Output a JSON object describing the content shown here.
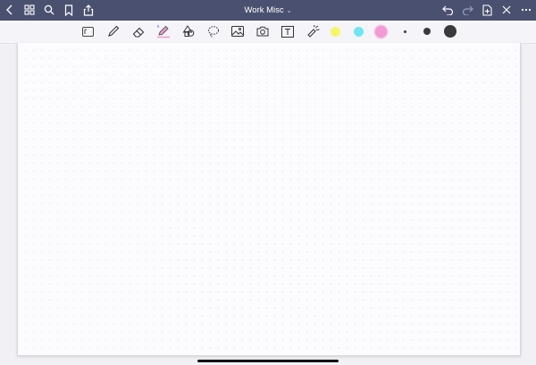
{
  "app": {
    "document_title": "Work Misc",
    "title_caret": "⌄"
  },
  "topbar_left": [
    {
      "name": "back-icon"
    },
    {
      "name": "grid-icon"
    },
    {
      "name": "search-icon"
    },
    {
      "name": "bookmark-icon"
    },
    {
      "name": "share-icon"
    }
  ],
  "topbar_right": [
    {
      "name": "undo-icon"
    },
    {
      "name": "redo-icon"
    },
    {
      "name": "add-page-icon"
    },
    {
      "name": "close-icon"
    },
    {
      "name": "more-icon"
    }
  ],
  "tools": [
    {
      "name": "read-only-icon"
    },
    {
      "name": "pen-icon"
    },
    {
      "name": "eraser-icon"
    },
    {
      "name": "highlighter-icon"
    },
    {
      "name": "shapes-icon"
    },
    {
      "name": "lasso-icon"
    },
    {
      "name": "image-icon"
    },
    {
      "name": "camera-icon"
    },
    {
      "name": "text-box-icon"
    },
    {
      "name": "laser-pointer-icon"
    }
  ],
  "colors": {
    "topbar": "#4a5170",
    "highlighter_yellow": "#f7f56a",
    "highlighter_cyan": "#6ee6ef",
    "highlighter_pink": "#f29ad3",
    "ink": "#3a3a3c",
    "accent_blue": "#4a6cf0"
  },
  "pen_sizes": [
    "small",
    "medium",
    "large"
  ],
  "selected_pen_size": "medium"
}
